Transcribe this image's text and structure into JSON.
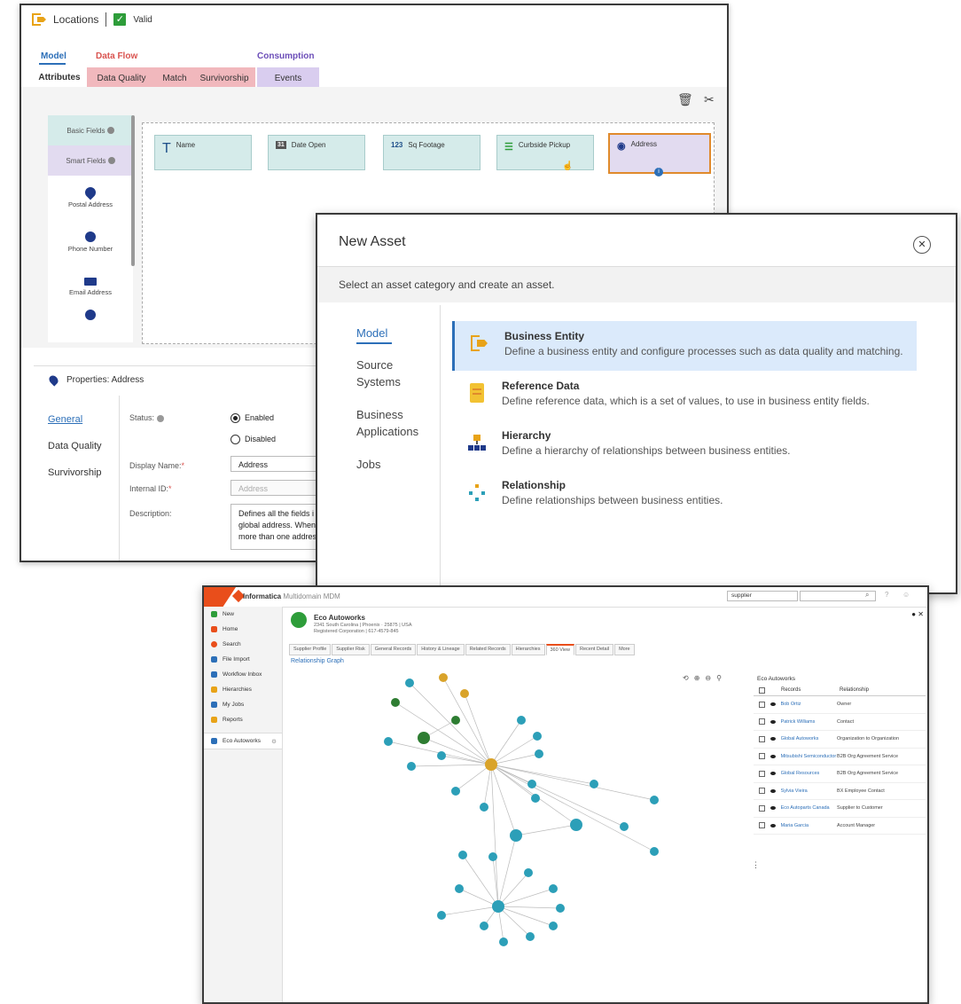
{
  "locations": {
    "title": "Locations",
    "status": "Valid",
    "tab_groups": [
      {
        "label": "Model",
        "color": "#2c6fb8"
      },
      {
        "label": "Data Flow",
        "color": "#d9534f"
      },
      {
        "label": "Consumption",
        "color": "#6b4db8"
      }
    ],
    "subtabs": [
      {
        "label": "Attributes",
        "bg": "#ffffff"
      },
      {
        "label": "Data Quality",
        "bg": "#f1b8bd"
      },
      {
        "label": "Match",
        "bg": "#f1b8bd"
      },
      {
        "label": "Survivorship",
        "bg": "#f1b8bd"
      },
      {
        "label": "Events",
        "bg": "#d9cdef"
      }
    ],
    "toolbar": {
      "delete_icon": "trash-icon",
      "cut_icon": "scissors-icon"
    },
    "palette": {
      "basic": "Basic Fields",
      "smart": "Smart Fields",
      "items": [
        "Postal Address",
        "Phone Number",
        "Email Address"
      ]
    },
    "fields": [
      {
        "icon": "T",
        "label": "Name"
      },
      {
        "icon": "31",
        "label": "Date Open"
      },
      {
        "icon": "123",
        "label": "Sq Footage"
      },
      {
        "icon": "☰",
        "label": "Curbside Pickup"
      },
      {
        "icon": "◉",
        "label": "Address"
      }
    ],
    "properties": {
      "title": "Properties: Address",
      "nav": [
        "General",
        "Data Quality",
        "Survivorship"
      ],
      "status_label": "Status:",
      "enabled": "Enabled",
      "disabled": "Disabled",
      "display_name_label": "Display Name:",
      "display_name_value": "Address",
      "internal_id_label": "Internal ID:",
      "internal_id_value": "Address",
      "description_label": "Description:",
      "description_value": "Defines all the fields i global address. When more than one addres"
    }
  },
  "new_asset": {
    "title": "New Asset",
    "subtitle": "Select an asset category and create an asset.",
    "nav": [
      "Model",
      "Source Systems",
      "Business Applications",
      "Jobs"
    ],
    "options": [
      {
        "title": "Business Entity",
        "desc": "Define a business entity and configure processes such as data quality and matching."
      },
      {
        "title": "Reference Data",
        "desc": "Define reference data, which is a set of values, to use in business entity fields."
      },
      {
        "title": "Hierarchy",
        "desc": "Define a hierarchy of relationships between business entities."
      },
      {
        "title": "Relationship",
        "desc": "Define relationships between business entities."
      }
    ]
  },
  "mdm": {
    "brand": "Informatica",
    "product": "Multidomain MDM",
    "search_value": "supplier",
    "nav": [
      "New",
      "Home",
      "Search",
      "File Import",
      "Workflow Inbox",
      "Hierarchies",
      "My Jobs",
      "Reports"
    ],
    "nav_selected": "Eco Autoworks",
    "entity_name": "Eco Autoworks",
    "entity_sub1": "2341 South Carolina | Phoenix · 25875 | USA",
    "entity_sub2": "Registered Corporation | 617-4579-845",
    "tabs": [
      "Supplier Profile",
      "Supplier Risk",
      "General Records",
      "History & Lineage",
      "Related Records",
      "Hierarchies",
      "360 View",
      "Recent Detail",
      "More"
    ],
    "active_tab": "360 View",
    "graph_label": "Relationship Graph",
    "panel_title": "Eco Autoworks",
    "panel_headers": [
      "Records",
      "Relationship"
    ],
    "relationships": [
      {
        "name": "Bob Ortiz",
        "rel": "Owner"
      },
      {
        "name": "Patrick Williams",
        "rel": "Contact"
      },
      {
        "name": "Global Autoworks",
        "rel": "Organization to Organization"
      },
      {
        "name": "Mitsubishi Semiconductor",
        "rel": "B2B Org Agreement Service"
      },
      {
        "name": "Global Resources",
        "rel": "B2B Org Agreement Service"
      },
      {
        "name": "Sylvia Vieira",
        "rel": "BX Employee Contact"
      },
      {
        "name": "Eco Autoparts Canada",
        "rel": "Supplier to Customer"
      },
      {
        "name": "Maria Garcia",
        "rel": "Account Manager"
      }
    ]
  }
}
